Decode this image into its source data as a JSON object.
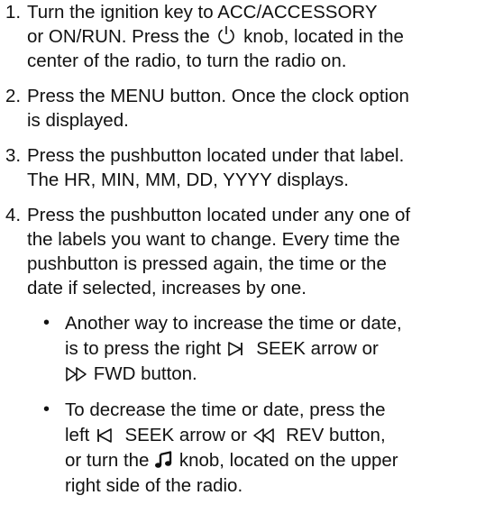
{
  "steps": [
    {
      "number": "1.",
      "lines": [
        "Turn the ignition key to ACC/ACCESSORY",
        {
          "before": "or ON/RUN. Press the ",
          "icon": "power-icon",
          "after": " knob, located in the"
        },
        "center of the radio, to turn the radio on."
      ]
    },
    {
      "number": "2.",
      "lines": [
        "Press the MENU button. Once the clock option",
        "is displayed."
      ]
    },
    {
      "number": "3.",
      "lines": [
        "Press the pushbutton located under that label.",
        "The HR, MIN, MM, DD, YYYY displays."
      ]
    },
    {
      "number": "4.",
      "lines": [
        "Press the pushbutton located under any one of",
        "the labels you want to change. Every time the",
        "pushbutton is pressed again, the time or the",
        "date if selected, increases by one."
      ],
      "bullets": [
        {
          "lines": [
            "Another way to increase the time or date,",
            {
              "before": "is to press the right ",
              "icon": "seek-right-icon",
              "after": "  SEEK arrow or"
            },
            {
              "before": "",
              "icon": "fast-forward-icon",
              "after": " FWD button."
            }
          ]
        },
        {
          "lines": [
            "To decrease the time or date, press the",
            {
              "before": "left ",
              "icon": "seek-left-icon",
              "after": "  SEEK arrow or ",
              "icon2": "rewind-icon",
              "after2": "  REV button,"
            },
            {
              "before": "or turn the ",
              "icon": "music-note-icon",
              "after": " knob, located on the upper"
            },
            "right side of the radio."
          ]
        }
      ]
    }
  ]
}
